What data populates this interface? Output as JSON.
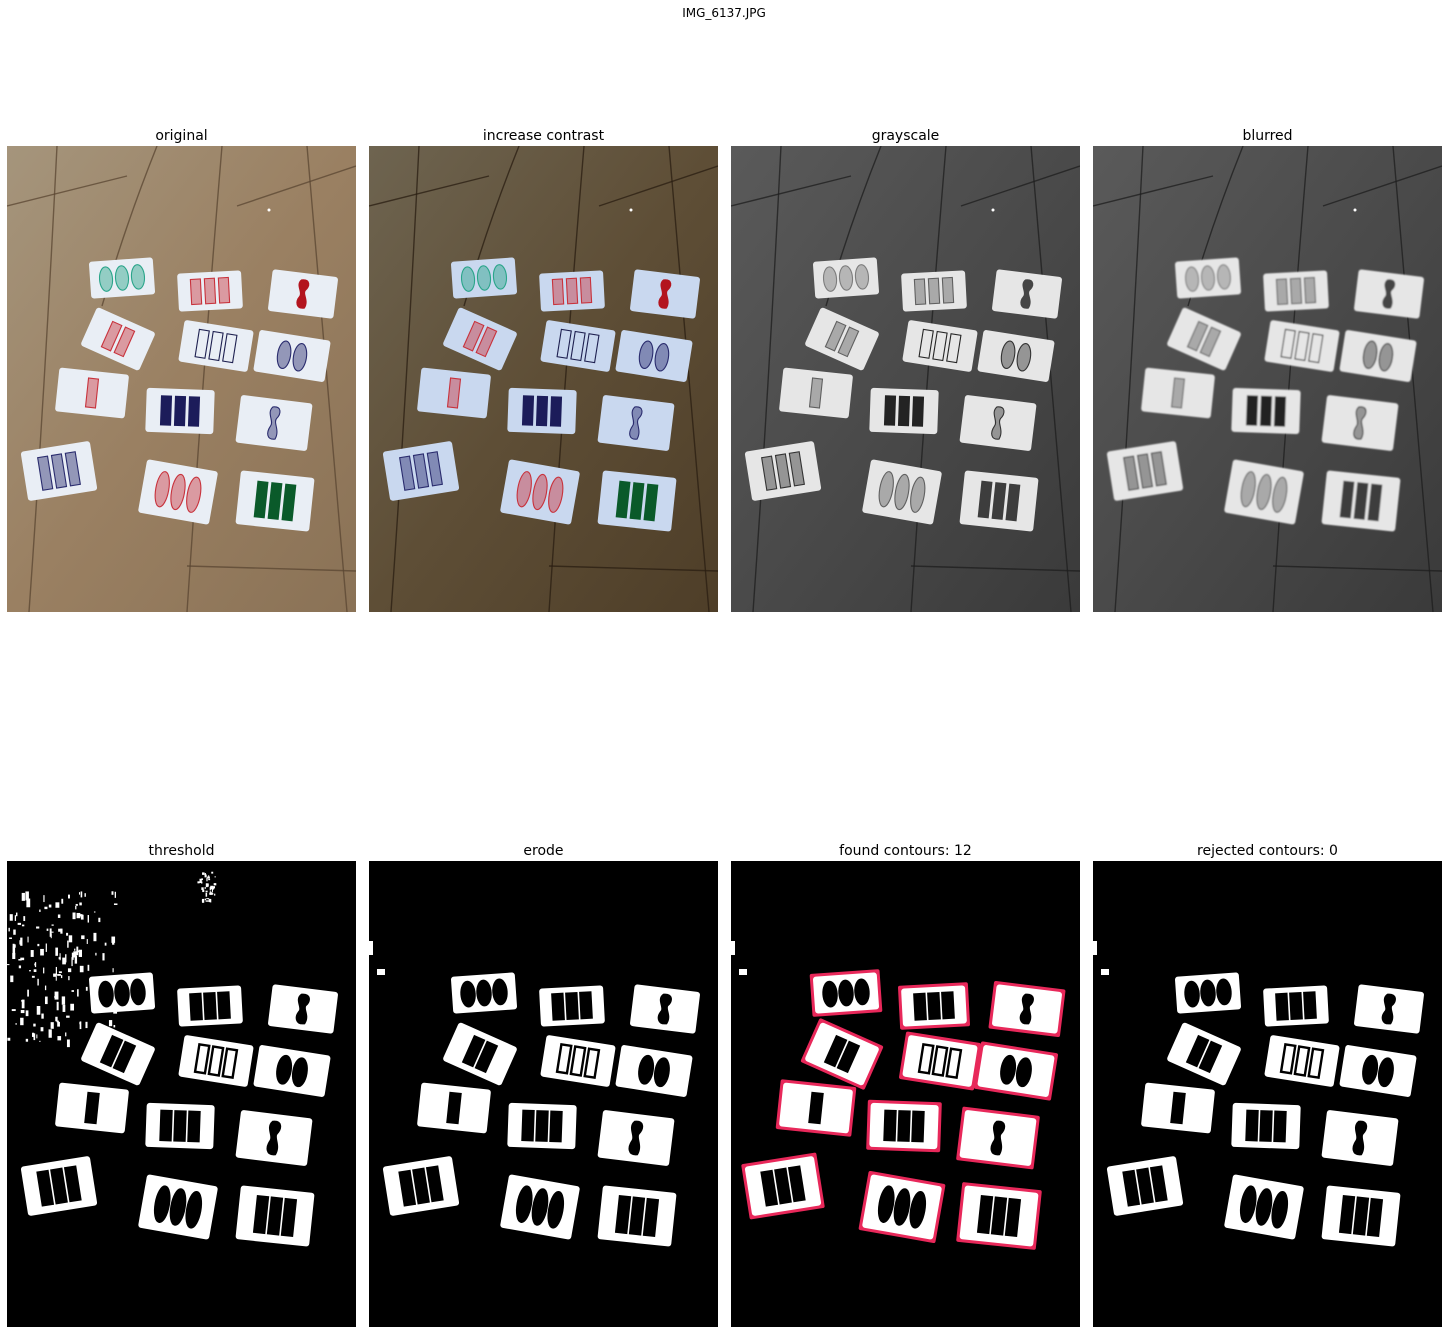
{
  "figure": {
    "title": "IMG_6137.JPG"
  },
  "panels": [
    {
      "id": "original",
      "title": "original",
      "style": "original"
    },
    {
      "id": "contrast",
      "title": "increase contrast",
      "style": "contrast"
    },
    {
      "id": "grayscale",
      "title": "grayscale",
      "style": "gray"
    },
    {
      "id": "blurred",
      "title": "blurred",
      "style": "blur"
    },
    {
      "id": "threshold",
      "title": "threshold",
      "style": "thresh"
    },
    {
      "id": "erode",
      "title": "erode",
      "style": "erode"
    },
    {
      "id": "found",
      "title": "found contours: 12",
      "style": "found"
    },
    {
      "id": "rejected",
      "title": "rejected contours: 0",
      "style": "rejected"
    }
  ],
  "contours": {
    "found_count": 12,
    "rejected_count": 0,
    "outline_color": "#e8285a"
  },
  "cards": [
    {
      "count": 3,
      "shape": "oval",
      "fill": "striped",
      "color": "#2aa58a"
    },
    {
      "count": 3,
      "shape": "rect",
      "fill": "striped",
      "color": "#c8323c"
    },
    {
      "count": 1,
      "shape": "squiggle",
      "fill": "solid",
      "color": "#b3141e"
    },
    {
      "count": 2,
      "shape": "rect",
      "fill": "striped",
      "color": "#c8323c"
    },
    {
      "count": 3,
      "shape": "rect",
      "fill": "empty",
      "color": "#1e2050"
    },
    {
      "count": 2,
      "shape": "oval",
      "fill": "striped",
      "color": "#2a2c6e"
    },
    {
      "count": 1,
      "shape": "rect",
      "fill": "striped",
      "color": "#c8323c"
    },
    {
      "count": 3,
      "shape": "rect",
      "fill": "solid",
      "color": "#1c1c5a"
    },
    {
      "count": 1,
      "shape": "squiggle",
      "fill": "striped",
      "color": "#2a2c6e"
    },
    {
      "count": 3,
      "shape": "rect",
      "fill": "striped",
      "color": "#2a2c6e"
    },
    {
      "count": 3,
      "shape": "oval",
      "fill": "striped",
      "color": "#c8323c"
    },
    {
      "count": 3,
      "shape": "rect",
      "fill": "solid",
      "color": "#0a5a2a"
    }
  ]
}
